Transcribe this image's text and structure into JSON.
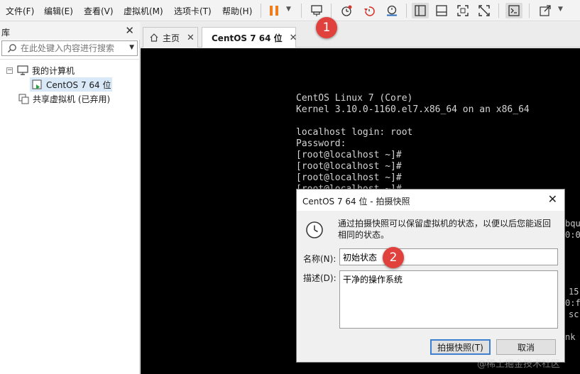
{
  "menu": [
    "文件(F)",
    "编辑(E)",
    "查看(V)",
    "虚拟机(M)",
    "选项卡(T)",
    "帮助(H)"
  ],
  "toolbar": {
    "icons": [
      "pause-icon",
      "send-keys-icon",
      "snapshot-icon",
      "revert-snapshot-icon",
      "snapshot-manager-icon",
      "show-library-icon",
      "thumbnail-bar-icon",
      "fullscreen-icon",
      "unity-icon",
      "console-icon",
      "stretch-icon"
    ]
  },
  "library": {
    "title": "库",
    "search_placeholder": "在此处键入内容进行搜索",
    "tree": {
      "root": "我的计算机",
      "vm": "CentOS 7 64 位",
      "shared": "共享虚拟机 (已弃用)"
    }
  },
  "tabs": [
    {
      "label": "主页",
      "active": false
    },
    {
      "label": "CentOS 7 64 位",
      "active": true
    }
  ],
  "console": {
    "lines": [
      "CentOS Linux 7 (Core)",
      "Kernel 3.10.0-1160.el7.x86_64 on an x86_64",
      "",
      "localhost login: root",
      "Password:",
      "[root@localhost ~]#",
      "[root@localhost ~]#",
      "[root@localhost ~]#",
      "[root@localhost ~]#"
    ],
    "fragments": [
      "bqu",
      "0:0",
      "15",
      "0:f",
      "sc",
      "nk"
    ]
  },
  "dialog": {
    "title": "CentOS 7 64 位 - 拍摄快照",
    "description": "通过拍摄快照可以保留虚拟机的状态，以便以后您能返回相同的状态。",
    "name_label": "名称(N):",
    "name_value": "初始状态",
    "desc_label": "描述(D):",
    "desc_value": "干净的操作系统",
    "snapshot_button": "拍摄快照(T)",
    "cancel_button": "取消"
  },
  "markers": [
    "1",
    "2"
  ],
  "watermark": "@稀土掘金技术社区",
  "colors": {
    "pause": "#f07d1c",
    "marker": "#e0413c",
    "console_bg": "#000000",
    "console_text": "#d4d4d4",
    "selection": "#d9e9f8"
  }
}
